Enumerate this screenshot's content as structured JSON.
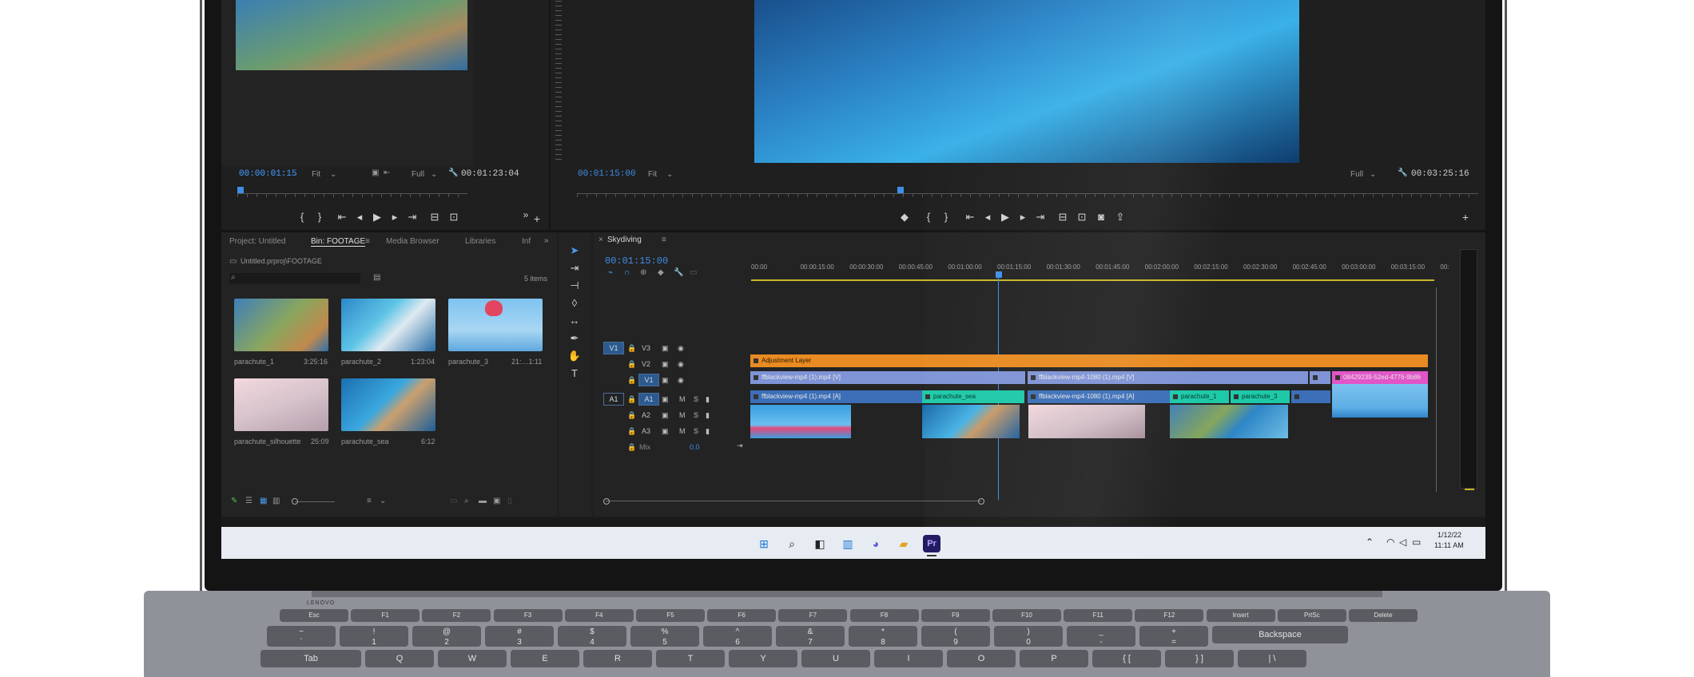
{
  "source_monitor": {
    "timecode": "00:00:01:15",
    "fit": "Fit",
    "quality": "Full",
    "duration": "00:01:23:04"
  },
  "program_monitor": {
    "timecode": "00:01:15:00",
    "fit": "Fit",
    "quality": "Full",
    "duration": "00:03:25:16"
  },
  "project_panel": {
    "tabs": [
      "Project: Untitled",
      "Bin: FOOTAGE",
      "Media Browser",
      "Libraries",
      "Inf"
    ],
    "path": "Untitled.prproj\\FOOTAGE",
    "item_count": "5 items",
    "clips": [
      {
        "name": "parachute_1",
        "duration": "3:25:16"
      },
      {
        "name": "parachute_2",
        "duration": "1:23:04"
      },
      {
        "name": "parachute_3",
        "duration": "21:…1:11"
      },
      {
        "name": "parachute_silhouette",
        "duration": "25:09"
      },
      {
        "name": "parachute_sea",
        "duration": "6:12"
      }
    ]
  },
  "timeline": {
    "sequence": "Skydiving",
    "timecode": "00:01:15:00",
    "ruler": [
      "00:00",
      "00:00:15:00",
      "00:00:30:00",
      "00:00:45:00",
      "00:01:00:00",
      "00:01:15:00",
      "00:01:30:00",
      "00:01:45:00",
      "00:02:00:00",
      "00:02:15:00",
      "00:02:30:00",
      "00:02:45:00",
      "00:03:00:00",
      "00:03:15:00",
      "00:"
    ],
    "tracks": {
      "video": [
        "V3",
        "V2",
        "V1"
      ],
      "audio": [
        "A1",
        "A2",
        "A3"
      ],
      "mix": "Mix",
      "mix_value": "0.0",
      "v_target": "V1",
      "a_target": "A1"
    },
    "clips": {
      "adjustment": "Adjustment Layer",
      "v1_a": "ffblackview-mp4 (1).mp4 [V]",
      "v1_b": "ffblackview-mp4-1080 (1).mp4 [V]",
      "v1_c": "08429239-52ed-4776-9b86",
      "a1_a": "ffblackview-mp4 (1).mp4 [A]",
      "a1_b": "parachute_sea",
      "a1_c": "ffblackview-mp4-1080 (1).mp4 [A]",
      "a1_d": "parachute_1",
      "a1_e": "parachute_3"
    }
  },
  "taskbar": {
    "date": "1/12/22",
    "time": "11:11 AM"
  },
  "keyboard": {
    "fn_row": [
      "Esc",
      "F1",
      "F2",
      "F3",
      "F4",
      "F5",
      "F6",
      "F7",
      "F8",
      "F9",
      "F10",
      "F11",
      "F12",
      "Insert",
      "PrtSc",
      "Delete"
    ],
    "num_row": [
      [
        "~",
        "`"
      ],
      [
        "!",
        "1"
      ],
      [
        "@",
        "2"
      ],
      [
        "#",
        "3"
      ],
      [
        "$",
        "4"
      ],
      [
        "%",
        "5"
      ],
      [
        "^",
        "6"
      ],
      [
        "&",
        "7"
      ],
      [
        "*",
        "8"
      ],
      [
        "(",
        "9"
      ],
      [
        ")",
        "0"
      ],
      [
        "_",
        "-"
      ],
      [
        "+",
        "="
      ]
    ],
    "backspace": "Backspace",
    "tab": "Tab",
    "q_row": [
      "Q",
      "W",
      "E",
      "R",
      "T",
      "Y",
      "U",
      "I",
      "O",
      "P",
      "{ [",
      "} ]",
      "| \\"
    ],
    "brand": "LENOVO"
  }
}
